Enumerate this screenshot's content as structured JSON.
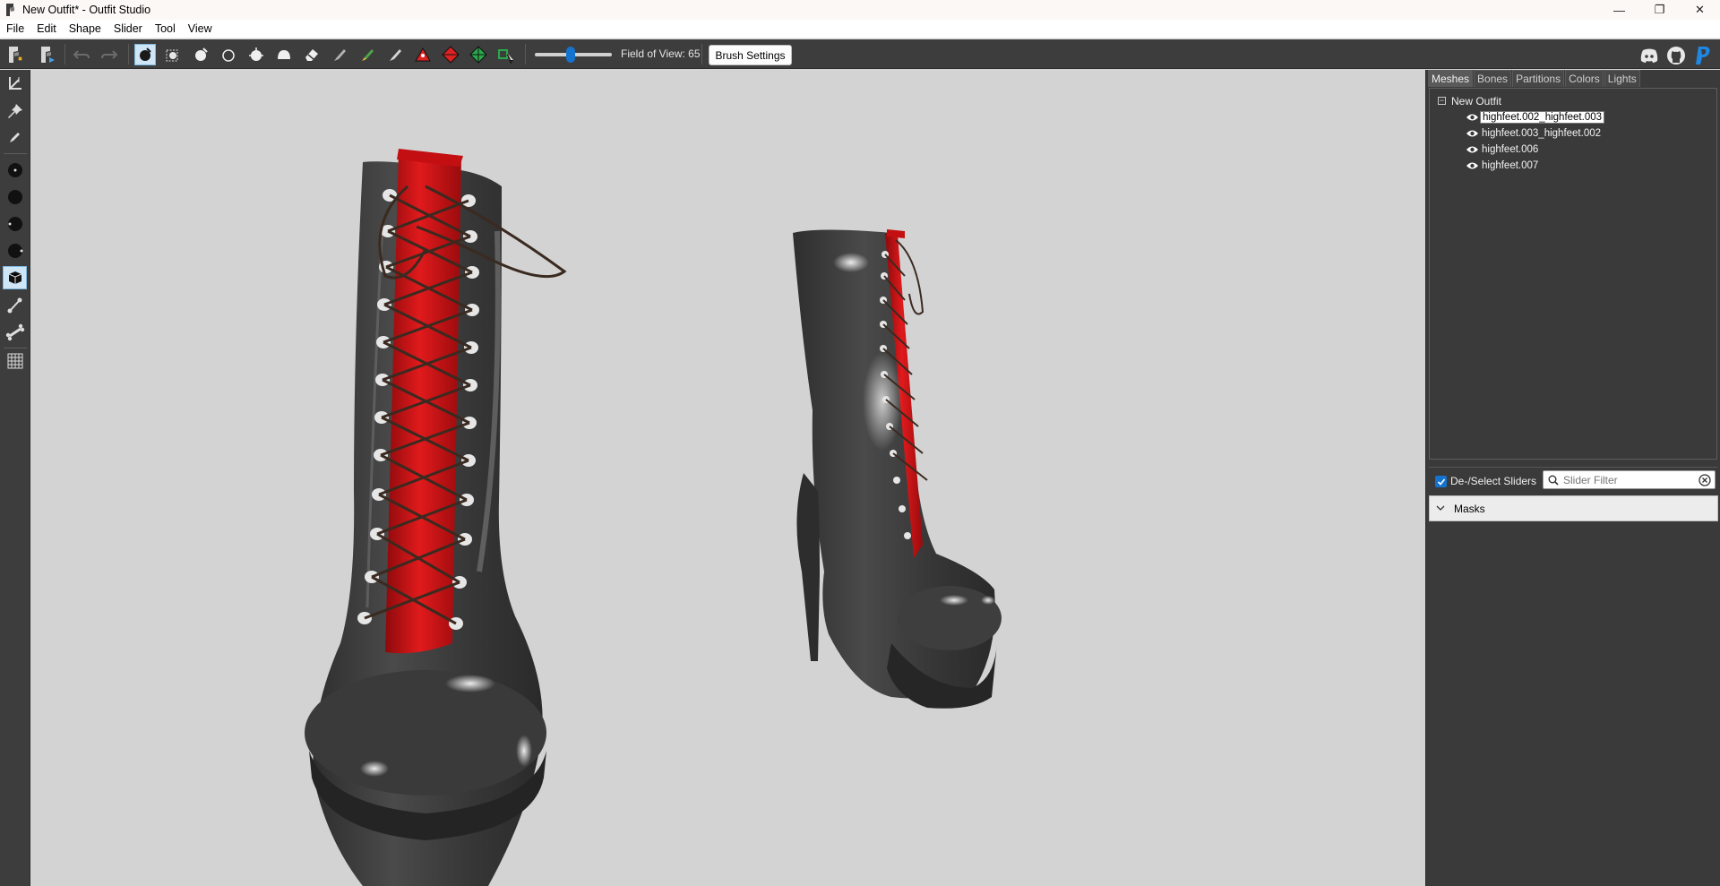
{
  "window": {
    "title": "New Outfit* - Outfit Studio",
    "minimize": "—",
    "maximize": "❐",
    "close": "✕"
  },
  "menu": [
    "File",
    "Edit",
    "Shape",
    "Slider",
    "Tool",
    "View"
  ],
  "toolbar": {
    "fov_label": "Field of View: 65",
    "fov_value": 65,
    "brush_settings_label": "Brush Settings",
    "icons": [
      "new-project-icon",
      "load-reference-icon",
      "undo-icon",
      "redo-icon",
      "select-brush-icon",
      "mask-brush-icon",
      "inflate-brush-icon",
      "deflate-brush-icon",
      "move-brush-icon",
      "smooth-brush-icon",
      "eraser-icon",
      "weight-brush-icon",
      "color-brush-icon",
      "alpha-brush-icon",
      "collapse-vertex-icon",
      "flip-edge-icon",
      "split-edge-icon",
      "delete-vertex-icon"
    ],
    "right_icons": [
      "discord-icon",
      "github-icon",
      "paypal-icon"
    ]
  },
  "left_tools": [
    "transform-icon",
    "pivot-icon",
    "pencil-icon",
    "vertex-small-icon",
    "vertex-large-icon",
    "brush-size-icon",
    "brush-strength-icon",
    "mesh-view-icon",
    "bone-edit-icon",
    "bone-icon",
    "grid-icon"
  ],
  "panel": {
    "tabs": [
      "Meshes",
      "Bones",
      "Partitions",
      "Colors",
      "Lights"
    ],
    "active_tab": "Meshes",
    "tree": {
      "root": "New Outfit",
      "toggle": "−",
      "meshes": [
        {
          "label": "highfeet.002_highfeet.003",
          "selected": true
        },
        {
          "label": "highfeet.003_highfeet.002",
          "selected": false
        },
        {
          "label": "highfeet.006",
          "selected": false
        },
        {
          "label": "highfeet.007",
          "selected": false
        }
      ]
    },
    "sliders": {
      "deselect_label": "De-/Select Sliders",
      "deselect_checked": true,
      "filter_placeholder": "Slider Filter",
      "masks_label": "Masks"
    }
  },
  "colors": {
    "toolbar_bg": "#3d3d3d",
    "viewport_bg": "#d3d3d3",
    "accent": "#1573d0",
    "boot_leather": "#3a3a3a",
    "boot_inset": "#c40f12"
  }
}
